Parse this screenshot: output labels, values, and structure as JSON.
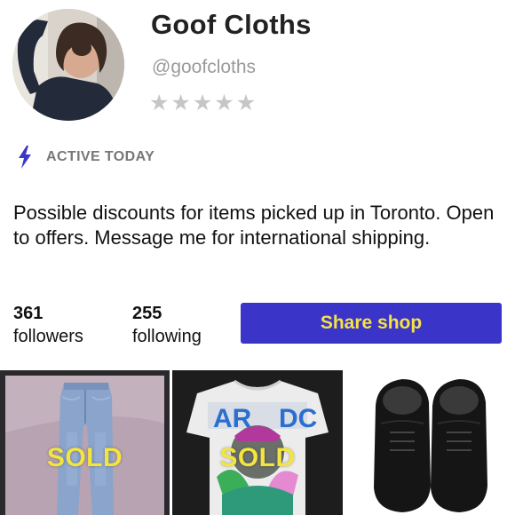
{
  "profile": {
    "shop_name": "Goof Cloths",
    "handle": "@goofcloths",
    "rating": 0,
    "stars": [
      "★",
      "★",
      "★",
      "★",
      "★"
    ],
    "star_empty_color": "#c6c6c6",
    "avatar_icon": "profile-photo"
  },
  "activity": {
    "icon": "lightning-bolt-icon",
    "label": "ACTIVE TODAY",
    "icon_color": "#3b37c8"
  },
  "bio": "Possible discounts for items picked up in Toronto. Open to offers. Message me for international shipping.",
  "stats": {
    "followers_count": "361",
    "followers_label": "followers",
    "following_count": "255",
    "following_label": "following"
  },
  "actions": {
    "share_label": "Share shop"
  },
  "colors": {
    "accent": "#3a34c9",
    "accent_text": "#f6e244",
    "sold_text": "#f3e43f"
  },
  "listings": [
    {
      "item": "jeans",
      "status": "SOLD"
    },
    {
      "item": "graphic-t-shirt",
      "status": "SOLD"
    },
    {
      "item": "black-leather-shoes",
      "status": ""
    }
  ]
}
